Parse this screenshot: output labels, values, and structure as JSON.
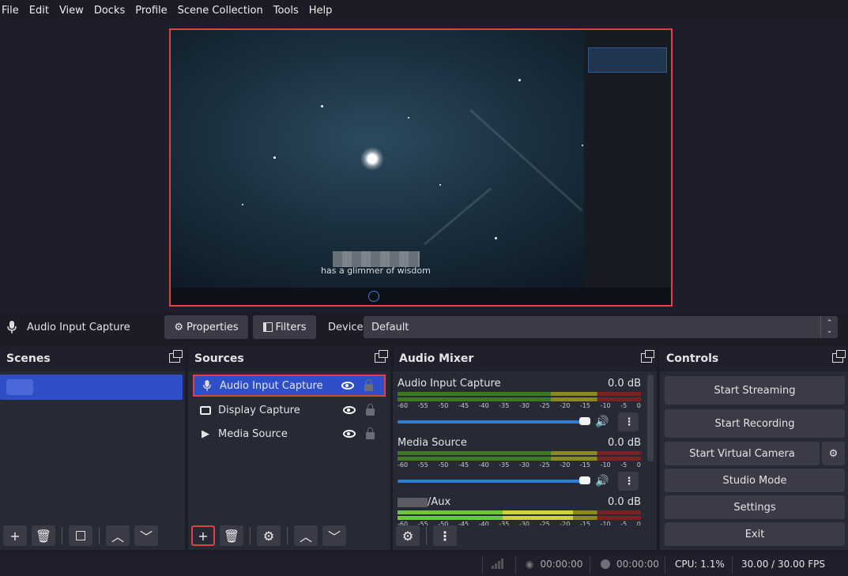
{
  "menu": [
    "File",
    "Edit",
    "View",
    "Docks",
    "Profile",
    "Scene Collection",
    "Tools",
    "Help"
  ],
  "preview": {
    "caption": "has a glimmer of wisdom"
  },
  "properties_bar": {
    "source_name": "Audio Input Capture",
    "properties_label": "Properties",
    "filters_label": "Filters",
    "device_label": "Device",
    "device_value": "Default"
  },
  "scenes": {
    "title": "Scenes"
  },
  "sources": {
    "title": "Sources",
    "items": [
      {
        "label": "Audio Input Capture",
        "icon": "microphone-icon"
      },
      {
        "label": "Display Capture",
        "icon": "monitor-icon"
      },
      {
        "label": "Media Source",
        "icon": "play-icon"
      }
    ]
  },
  "mixer": {
    "title": "Audio Mixer",
    "ticks": [
      "-60",
      "-55",
      "-50",
      "-45",
      "-40",
      "-35",
      "-30",
      "-25",
      "-20",
      "-15",
      "-10",
      "-5",
      "0"
    ],
    "channels": [
      {
        "name": "Audio Input Capture",
        "db": "0.0 dB"
      },
      {
        "name": "Media Source",
        "db": "0.0 dB"
      },
      {
        "name": "/Aux",
        "db": "0.0 dB"
      }
    ]
  },
  "controls": {
    "title": "Controls",
    "start_streaming": "Start Streaming",
    "start_recording": "Start Recording",
    "start_virtual_camera": "Start Virtual Camera",
    "studio_mode": "Studio Mode",
    "settings": "Settings",
    "exit": "Exit"
  },
  "status": {
    "stream_time": "00:00:00",
    "record_time": "00:00:00",
    "cpu": "CPU: 1.1%",
    "fps": "30.00 / 30.00 FPS"
  },
  "colors": {
    "highlight": "#e0433f",
    "selection": "#2f4fc6",
    "accent": "#2e7fd6"
  }
}
